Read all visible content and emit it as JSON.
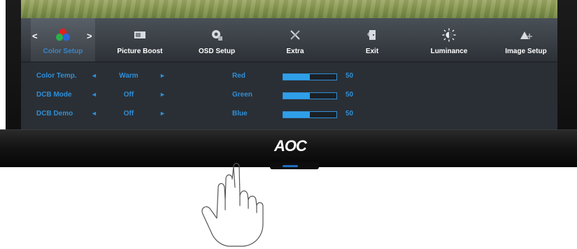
{
  "brand": {
    "logo": "AOC"
  },
  "menu": {
    "tabs": [
      {
        "label": "Color Setup",
        "icon": "rgb-dots-icon",
        "active": true
      },
      {
        "label": "Picture Boost",
        "icon": "picture-boost-icon"
      },
      {
        "label": "OSD Setup",
        "icon": "osd-setup-icon"
      },
      {
        "label": "Extra",
        "icon": "extra-tools-icon"
      },
      {
        "label": "Exit",
        "icon": "exit-door-icon"
      },
      {
        "label": "Luminance",
        "icon": "luminance-sun-icon"
      },
      {
        "label": "Image Setup",
        "icon": "image-setup-icon"
      }
    ],
    "prev_arrow": "<",
    "next_arrow": ">"
  },
  "settings": {
    "left_arrow": "◄",
    "right_arrow": "►",
    "rows": [
      {
        "name": "Color Temp.",
        "value": "Warm"
      },
      {
        "name": "DCB Mode",
        "value": "Off"
      },
      {
        "name": "DCB Demo",
        "value": "Off"
      }
    ],
    "channels": [
      {
        "name": "Red",
        "value": 50
      },
      {
        "name": "Green",
        "value": 50
      },
      {
        "name": "Blue",
        "value": 50
      }
    ]
  },
  "colors": {
    "accent": "#2f8fd8",
    "bar_fill": "#2f9fe8",
    "panel": "#2a2f35",
    "led": "#1f6fc0"
  }
}
